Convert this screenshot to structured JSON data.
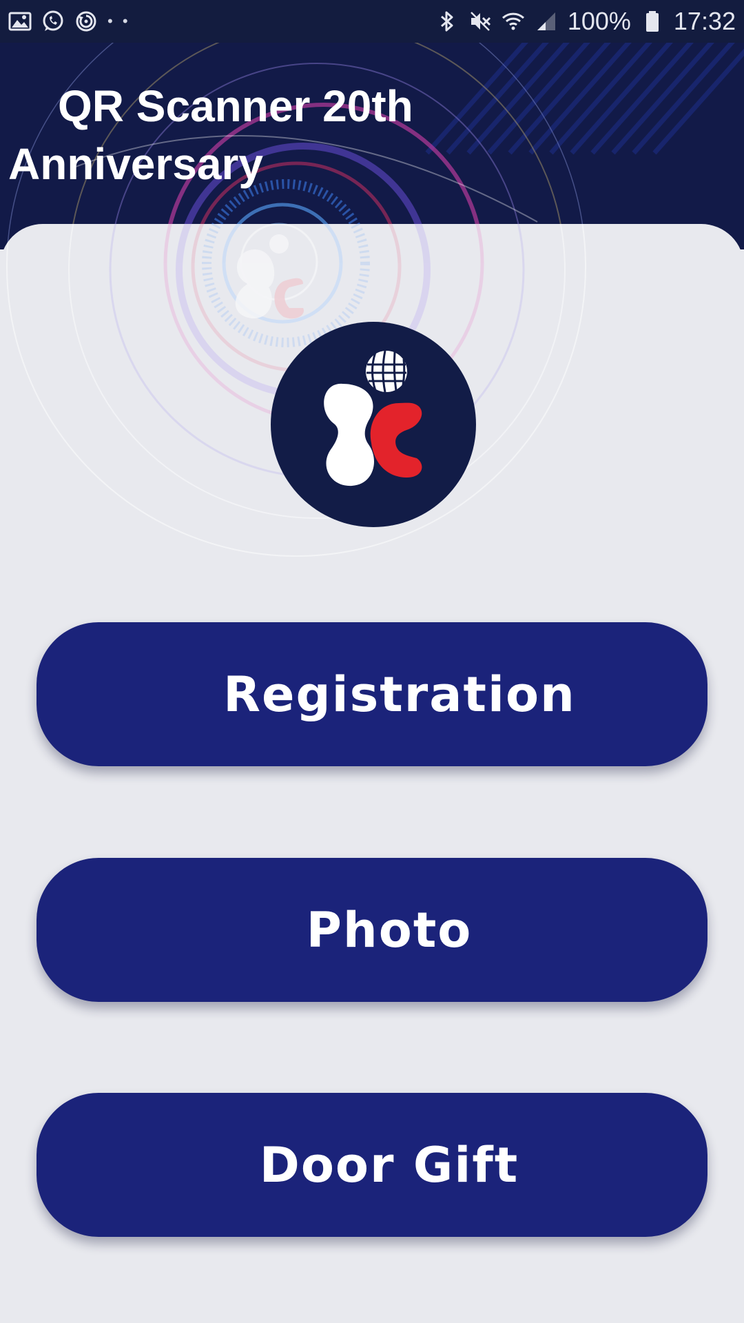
{
  "status_bar": {
    "left_icons": [
      "gallery-icon",
      "whatsapp-icon",
      "sync-icon"
    ],
    "overflow_dots": "• •",
    "right_icons": [
      "bluetooth-icon",
      "mute-icon",
      "wifi-icon",
      "signal-icon"
    ],
    "battery": "100%",
    "battery_icon": "battery-icon",
    "time": "17:32"
  },
  "header": {
    "title": "QR Scanner 20th Anniversary"
  },
  "logo": {
    "icon": "company-logo",
    "colors": {
      "background": "#121c47",
      "white_shape": "#ffffff",
      "red_shape": "#e3232b"
    }
  },
  "buttons": {
    "registration": "Registration",
    "photo": "Photo",
    "door_gift": "Door Gift"
  },
  "colors": {
    "header_bg": "#121a48",
    "panel_bg": "#e8e9ee",
    "button_bg": "#1b237a",
    "button_text": "#ffffff"
  }
}
